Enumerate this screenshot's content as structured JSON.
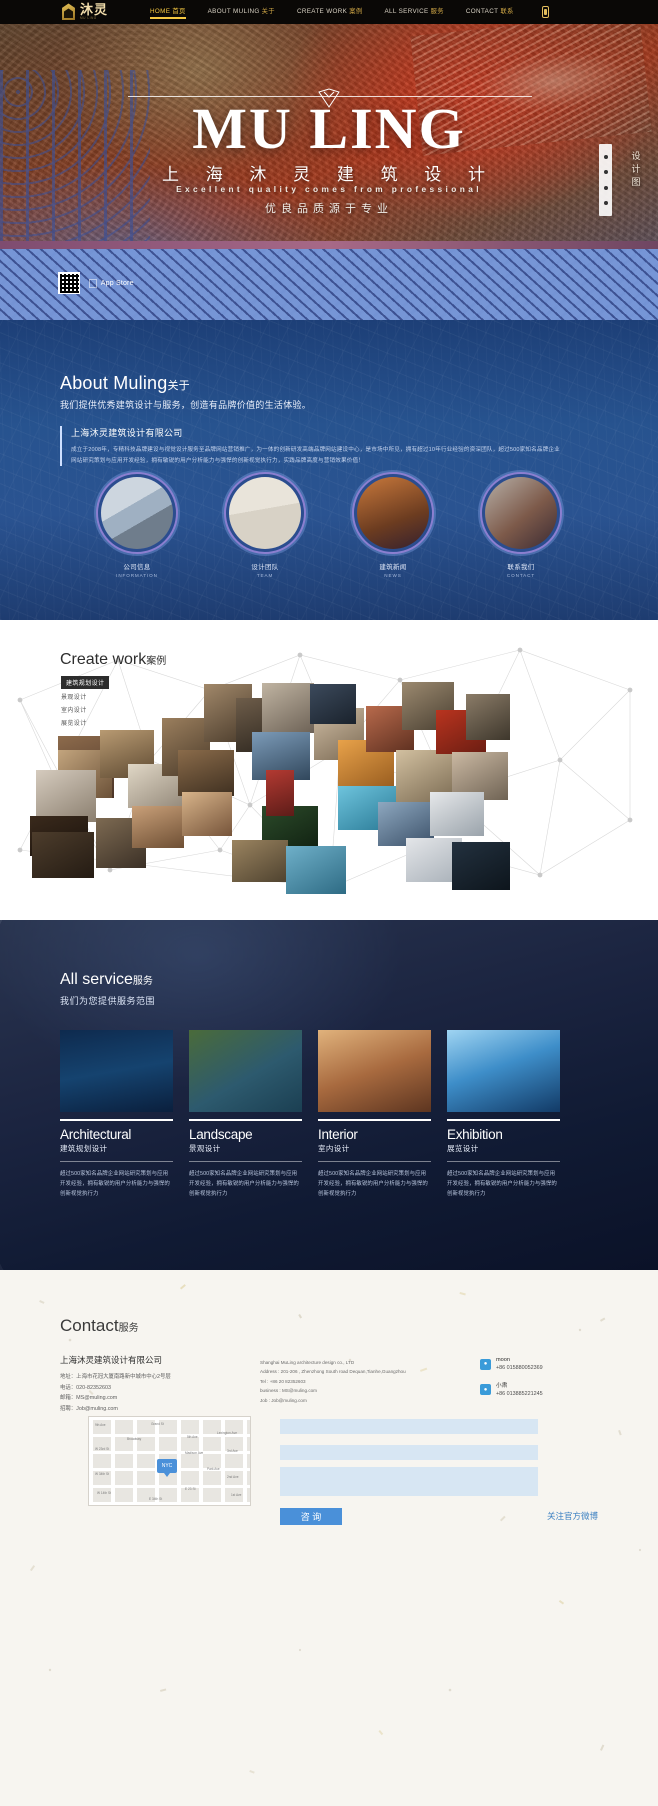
{
  "nav": {
    "logo_cn": "沐灵",
    "logo_en": "MU LING",
    "items": [
      {
        "en": "HOME",
        "cn": "首页",
        "active": true
      },
      {
        "en": "ABOUT MULING",
        "cn": "关于",
        "active": false
      },
      {
        "en": "CREATE WORK",
        "cn": "案例",
        "active": false
      },
      {
        "en": "ALL SERVICE",
        "cn": "服务",
        "active": false
      },
      {
        "en": "CONTACT",
        "cn": "联系",
        "active": false
      }
    ],
    "phone_icon": "mobile-phone-icon"
  },
  "hero": {
    "title": "MU LING",
    "subtitle_cn": "上 海 沐 灵 建 筑 设 计",
    "tagline_en": "Excellent quality comes from professional",
    "tagline_cn": "优良品质源于专业",
    "side_text": "设计图",
    "qr_label": "qr-code",
    "appstore": "App Store"
  },
  "about": {
    "heading_en": "About Muling",
    "heading_cn": "关于",
    "lead": "我们提供优秀建筑设计与服务，创造有品牌价值的生活体验。",
    "card_title": "上海沐灵建筑设计有限公司",
    "card_body": "成立于2008年，专精科技品牌建设与视觉设计服务至品牌网站营销推广，为一体的创新研发高端品牌网站建设中心，是市场中所见，拥有超过10年行业经验的资深团队，超过500家知名品牌企业网站研究策划与应用开发经验，拥有敏锐的用户分析能力与强悍的创新视觉执行力，实践品牌高度与营销效果价值！",
    "circles": [
      {
        "cn": "公司信息",
        "en": "INFORMATION"
      },
      {
        "cn": "设计团队",
        "en": "TEAM"
      },
      {
        "cn": "建筑新闻",
        "en": "NEWS"
      },
      {
        "cn": "联系我们",
        "en": "CONTACT"
      }
    ]
  },
  "work": {
    "heading_en": "Create work",
    "heading_cn": "案例",
    "tabs": [
      {
        "label": "建筑规划设计",
        "active": true
      },
      {
        "label": "景观设计",
        "active": false
      },
      {
        "label": "室内设计",
        "active": false
      },
      {
        "label": "展览设计",
        "active": false
      }
    ]
  },
  "service": {
    "heading_en": "All service",
    "heading_cn": "服务",
    "sub": "我们为您提供服务范围",
    "items": [
      {
        "en": "Architectural",
        "cn": "建筑规划设计",
        "desc": "超过500家知名品牌企业网站研究策划与应用开发经验，拥有敏锐的用户分析能力与强悍的创新视觉执行力"
      },
      {
        "en": "Landscape",
        "cn": "景观设计",
        "desc": "超过500家知名品牌企业网站研究策划与应用开发经验，拥有敏锐的用户分析能力与强悍的创新视觉执行力"
      },
      {
        "en": "Interior",
        "cn": "室内设计",
        "desc": "超过500家知名品牌企业网站研究策划与应用开发经验，拥有敏锐的用户分析能力与强悍的创新视觉执行力"
      },
      {
        "en": "Exhibition",
        "cn": "展览设计",
        "desc": "超过500家知名品牌企业网站研究策划与应用开发经验，拥有敏锐的用户分析能力与强悍的创新视觉执行力"
      }
    ]
  },
  "contact": {
    "heading_en": "Contact",
    "heading_cn": "服务",
    "company_cn": "上海沐灵建筑设计有限公司",
    "addr_cn": "地址：上海市花冠大厦南路新中城市中心2号层",
    "tel_cn": "电话：020-82352603",
    "email_cn": "邮箱：MS@muling.com",
    "job_cn": "招聘：Job@muling.com",
    "company_en": "Shanghai MuLing architecture design co., LTD",
    "addr_en": "Address : 201-206 , Zhenzhong South road Dequan,Tianhe,Guangzhou",
    "tel_en": "Tel : +86 20 82352603",
    "business_en": "business : MS@muling.com",
    "job_en": "Job : Job@muling.com",
    "socials": [
      {
        "icon": "chat-bubble-icon",
        "name": "moon",
        "number": "+86 015880052369"
      },
      {
        "icon": "chat-bubble-icon",
        "name": "小肃",
        "number": "+86 013885221245"
      }
    ],
    "map": {
      "pin_label": "NYC",
      "labels": [
        "9th Ave",
        "Grand St",
        "W 23rd St",
        "W 34th St",
        "Broadway",
        "5th Ave",
        "Madison Ave",
        "Park Ave",
        "W 14th St",
        "E 23 St",
        "Lexington Ave",
        "3rd Ave",
        "2nd Ave",
        "1st Ave",
        "E 34th St"
      ]
    },
    "form": {
      "field1": "",
      "field1_placeholder": "",
      "field2": "",
      "field2_placeholder": "",
      "message": "",
      "message_placeholder": "",
      "submit_label": "咨 询"
    },
    "weibo_link": "关注官方微博"
  },
  "colors": {
    "nav_bg": "#0a0806",
    "accent_gold": "#f5c842",
    "about_blue": "#27538f",
    "service_dark": "#101a33",
    "contact_bg": "#f7f5f0",
    "form_blue": "#d7e6f3",
    "button_blue": "#4a90d9"
  }
}
